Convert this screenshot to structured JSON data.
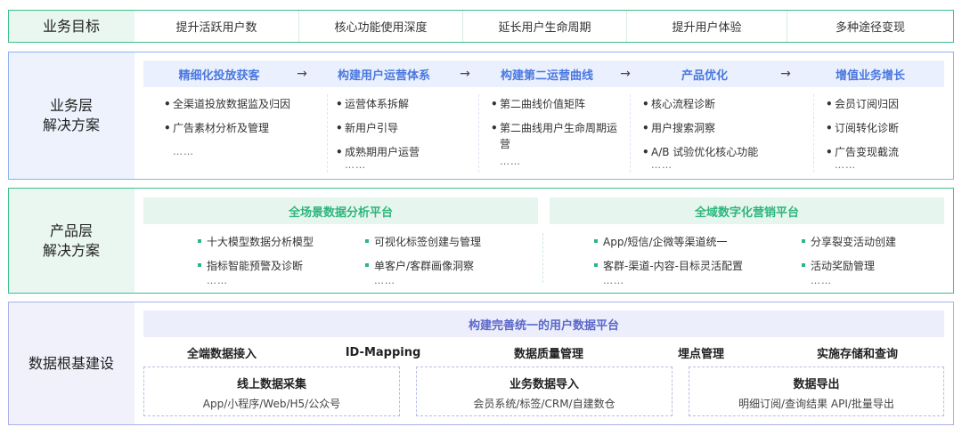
{
  "goals": {
    "label": "业务目标",
    "items": [
      "提升活跃用户数",
      "核心功能使用深度",
      "延长用户生命周期",
      "提升用户体验",
      "多种途径变现"
    ]
  },
  "business": {
    "label_line1": "业务层",
    "label_line2": "解决方案",
    "steps": [
      {
        "title": "精细化投放获客",
        "bullets": [
          "全渠道投放数据监及归因",
          "广告素材分析及管理"
        ],
        "more": "……"
      },
      {
        "title": "构建用户运营体系",
        "bullets": [
          "运营体系拆解",
          "新用户引导",
          "成熟期用户运营"
        ],
        "more": "……"
      },
      {
        "title": "构建第二运营曲线",
        "bullets": [
          "第二曲线价值矩阵",
          "第二曲线用户生命周期运营"
        ],
        "more": "……"
      },
      {
        "title": "产品优化",
        "bullets": [
          "核心流程诊断",
          "用户搜索洞察",
          "A/B 试验优化核心功能"
        ],
        "more": "……"
      },
      {
        "title": "增值业务增长",
        "bullets": [
          "会员订阅归因",
          "订阅转化诊断",
          "广告变现截流"
        ],
        "more": "……"
      }
    ],
    "arrow": "→"
  },
  "product": {
    "label_line1": "产品层",
    "label_line2": "解决方案",
    "platforms": [
      {
        "title": "全场景数据分析平台",
        "col1": [
          "十大模型数据分析模型",
          "指标智能预警及诊断"
        ],
        "col2": [
          "可视化标签创建与管理",
          "单客户/客群画像洞察"
        ],
        "more": "……"
      },
      {
        "title": "全域数字化营销平台",
        "col1": [
          "App/短信/企微等渠道统一",
          "客群-渠道-内容-目标灵活配置"
        ],
        "col2": [
          "分享裂变活动创建",
          "活动奖励管理"
        ],
        "more": "……"
      }
    ]
  },
  "foundation": {
    "label": "数据根基建设",
    "header": "构建完善统一的用户数据平台",
    "capabilities": [
      "全端数据接入",
      "ID-Mapping",
      "数据质量管理",
      "埋点管理",
      "实施存储和查询"
    ],
    "boxes": [
      {
        "title": "线上数据采集",
        "desc": "App/小程序/Web/H5/公众号"
      },
      {
        "title": "业务数据导入",
        "desc": "会员系统/标签/CRM/自建数仓"
      },
      {
        "title": "数据导出",
        "desc": "明细订阅/查询结果 API/批量导出"
      }
    ]
  },
  "colors": {
    "goals_border": "#3dbf8a",
    "business_border": "#8fb0f0",
    "product_border": "#3dbf8a",
    "foundation_border": "#aab0e8",
    "step_blue": "#4a78e0",
    "green_accent": "#2fb67c",
    "lilac_header": "#eceefb"
  }
}
